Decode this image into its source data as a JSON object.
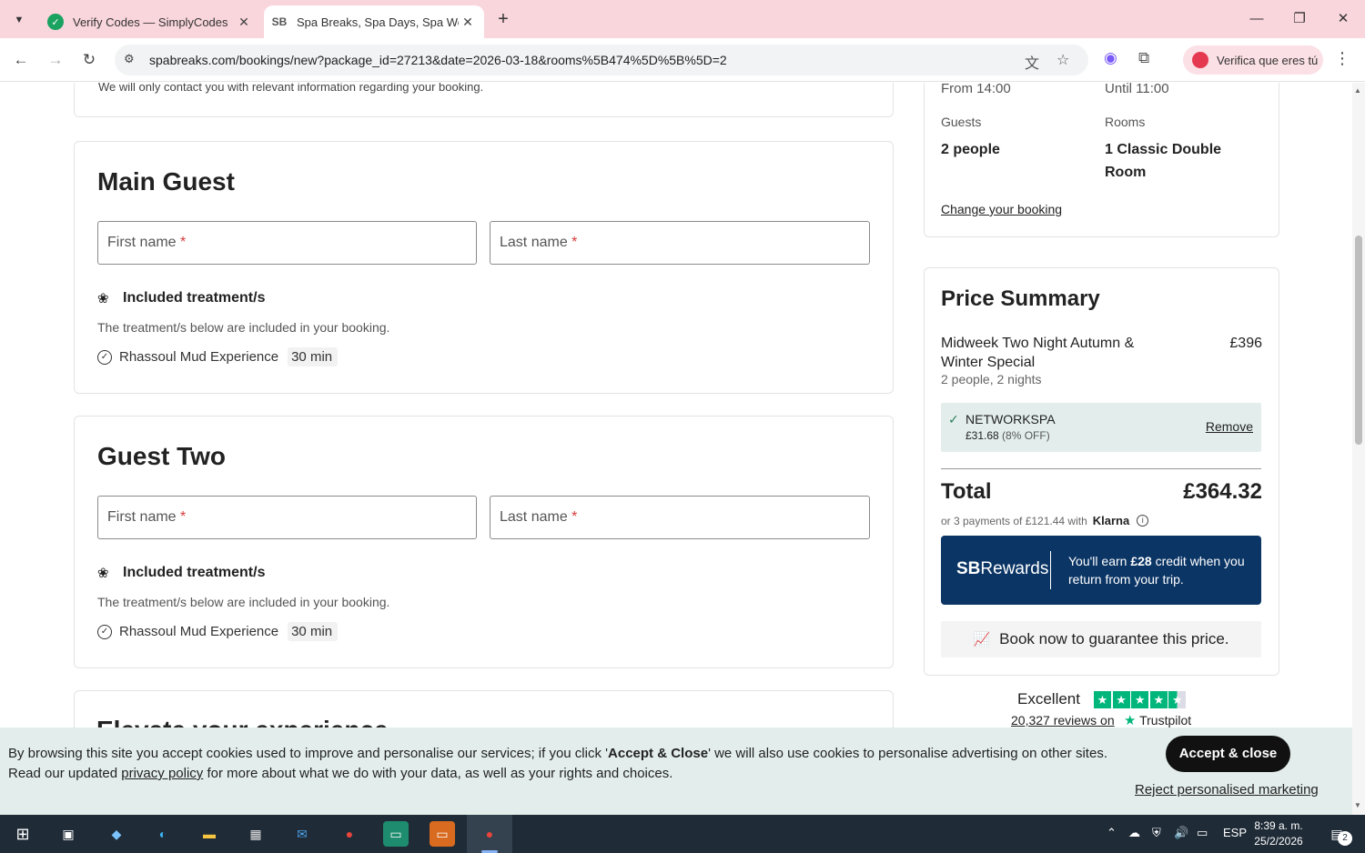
{
  "browser": {
    "tabs": [
      {
        "title": "Verify Codes — SimplyCodes",
        "active": false
      },
      {
        "title": "Spa Breaks, Spa Days, Spa Weeke",
        "active": true
      }
    ],
    "favicon_sb": "SB",
    "url": "spabreaks.com/bookings/new?package_id=27213&date=2026-03-18&rooms%5B474%5D%5B%5D=2",
    "profile_label": "Verifica que eres tú"
  },
  "page": {
    "contact_note": "We will only contact you with relevant information regarding your booking.",
    "guests": [
      {
        "title": "Main Guest",
        "first_name_placeholder": "First name",
        "last_name_placeholder": "Last name",
        "required_mark": "*",
        "treatments_heading": "Included treatment/s",
        "treatments_desc": "The treatment/s below are included in your booking.",
        "treatment_name": "Rhassoul Mud Experience",
        "treatment_duration": "30 min"
      },
      {
        "title": "Guest Two",
        "first_name_placeholder": "First name",
        "last_name_placeholder": "Last name",
        "required_mark": "*",
        "treatments_heading": "Included treatment/s",
        "treatments_desc": "The treatment/s below are included in your booking.",
        "treatment_name": "Rhassoul Mud Experience",
        "treatment_duration": "30 min"
      }
    ],
    "next_section_title": "Elevate your experience"
  },
  "booking_summary": {
    "checkin": "From 14:00",
    "checkout": "Until 11:00",
    "guests_label": "Guests",
    "guests_value": "2 people",
    "rooms_label": "Rooms",
    "rooms_value": "1 Classic Double Room",
    "change_link": "Change your booking"
  },
  "price_summary": {
    "title": "Price Summary",
    "item_name": "Midweek Two Night Autumn & Winter Special",
    "item_price": "£396",
    "item_detail": "2 people, 2 nights",
    "promo_code": "NETWORKSPA",
    "promo_amount": "£31.68",
    "promo_pct": "(8% OFF)",
    "promo_remove": "Remove",
    "total_label": "Total",
    "total_value": "£364.32",
    "installments": "or 3 payments of £121.44 with",
    "klarna": "Klarna",
    "rewards_logo_a": "SB",
    "rewards_logo_b": "Rewards",
    "rewards_text_a": "You'll earn ",
    "rewards_text_b": "£28",
    "rewards_text_c": " credit when you return from your trip.",
    "guarantee": "Book now to guarantee this price."
  },
  "trustpilot": {
    "rating_word": "Excellent",
    "reviews_link": "20,327 reviews on",
    "brand": "Trustpilot",
    "stars": 4.5
  },
  "cookie_banner": {
    "text_a": "By browsing this site you accept cookies used to improve and personalise our services; if you click '",
    "text_bold": "Accept & Close",
    "text_b": "' we will also use cookies to personalise advertising on other sites.",
    "text_c": "Read our updated ",
    "privacy_link": "privacy policy",
    "text_d": " for more about what we do with your data, as well as your rights and choices.",
    "accept": "Accept & close",
    "reject": "Reject personalised marketing"
  },
  "taskbar": {
    "time": "8:39 a. m.",
    "date": "25/2/2026",
    "language": "ESP",
    "notifications": "2"
  }
}
